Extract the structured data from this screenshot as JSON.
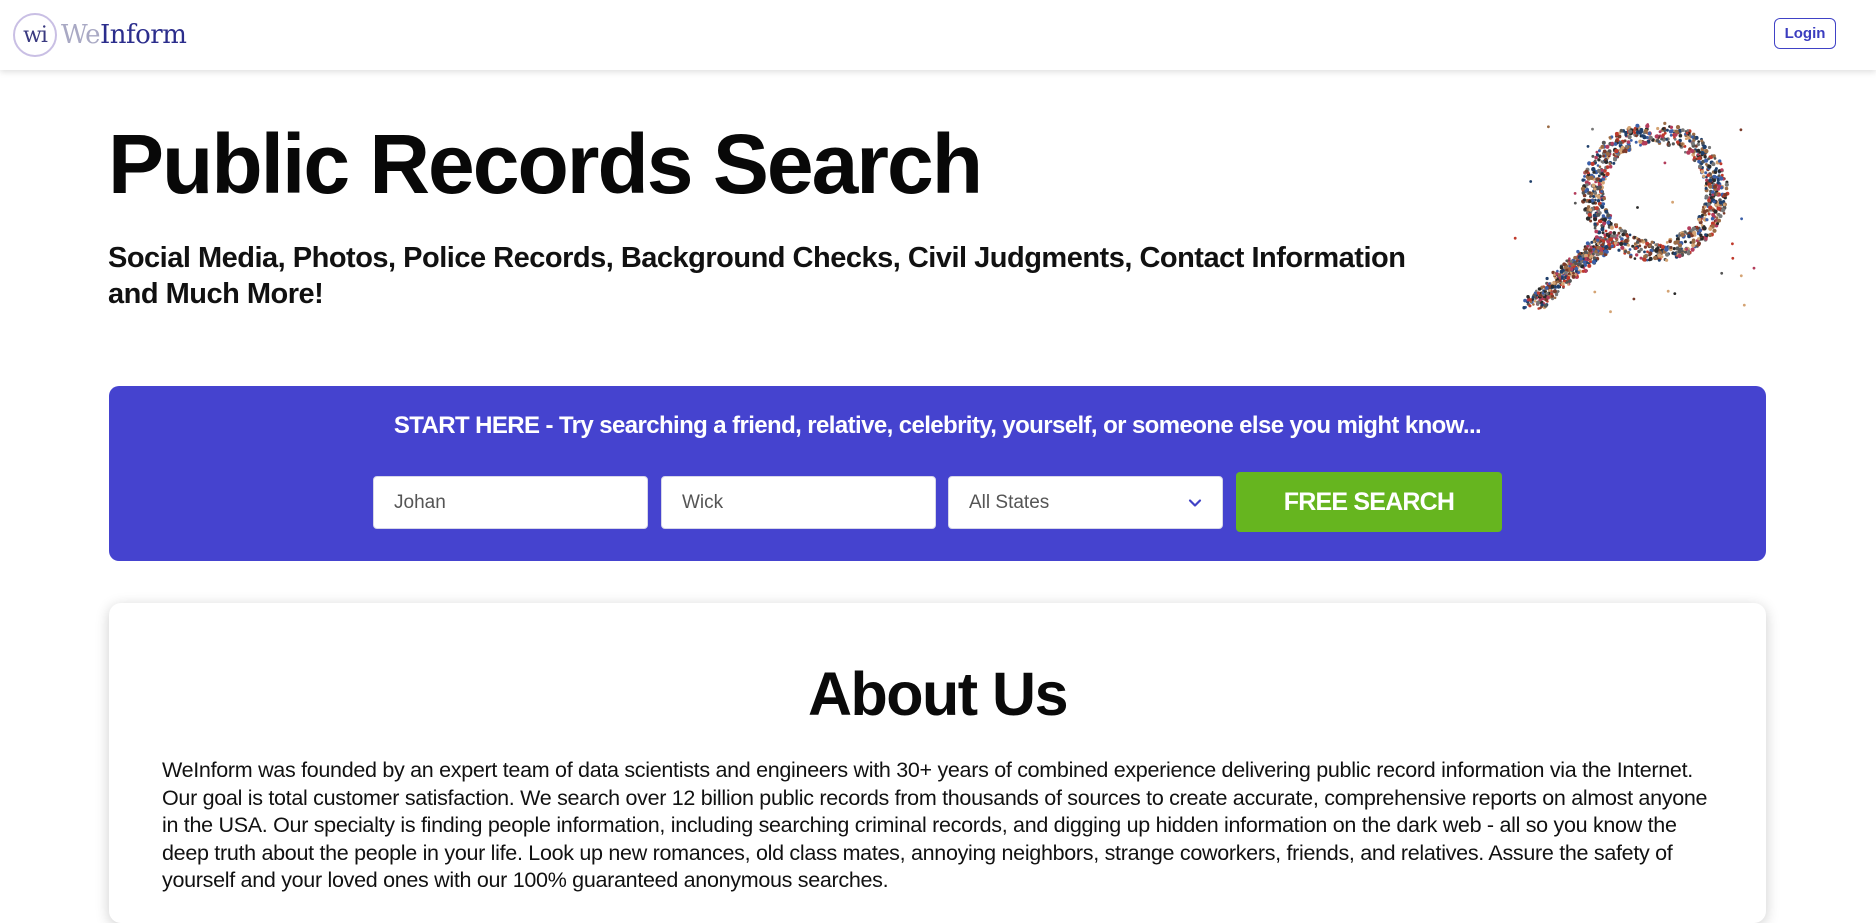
{
  "header": {
    "logo_badge": "wi",
    "logo_we": "We",
    "logo_inform": "Inform",
    "login_label": "Login"
  },
  "hero": {
    "title": "Public Records Search",
    "subtitle": "Social Media, Photos, Police Records, Background Checks, Civil Judgments, Contact Information and Much More!",
    "image_icon": "crowd-magnifying-glass-illustration"
  },
  "search": {
    "heading": "START HERE - Try searching a friend, relative, celebrity, yourself, or someone else you might know...",
    "first_name_value": "Johan",
    "last_name_value": "Wick",
    "state_selected": "All States",
    "button_label": "FREE SEARCH",
    "colors": {
      "panel": "#4543cf",
      "button": "#66b51f"
    }
  },
  "about": {
    "title": "About Us",
    "body": "WeInform was founded by an expert team of data scientists and engineers with 30+ years of combined experience delivering public record information via the Internet. Our goal is total customer satisfaction. We search over 12 billion public records from thousands of sources to create accurate, comprehensive reports on almost anyone in the USA. Our specialty is finding people information, including searching criminal records, and digging up hidden information on the dark web - all so you know the deep truth about the people in your life. Look up new romances, old class mates, annoying neighbors, strange coworkers, friends, and relatives. Assure the safety of yourself and your loved ones with our 100% guaranteed anonymous searches."
  }
}
